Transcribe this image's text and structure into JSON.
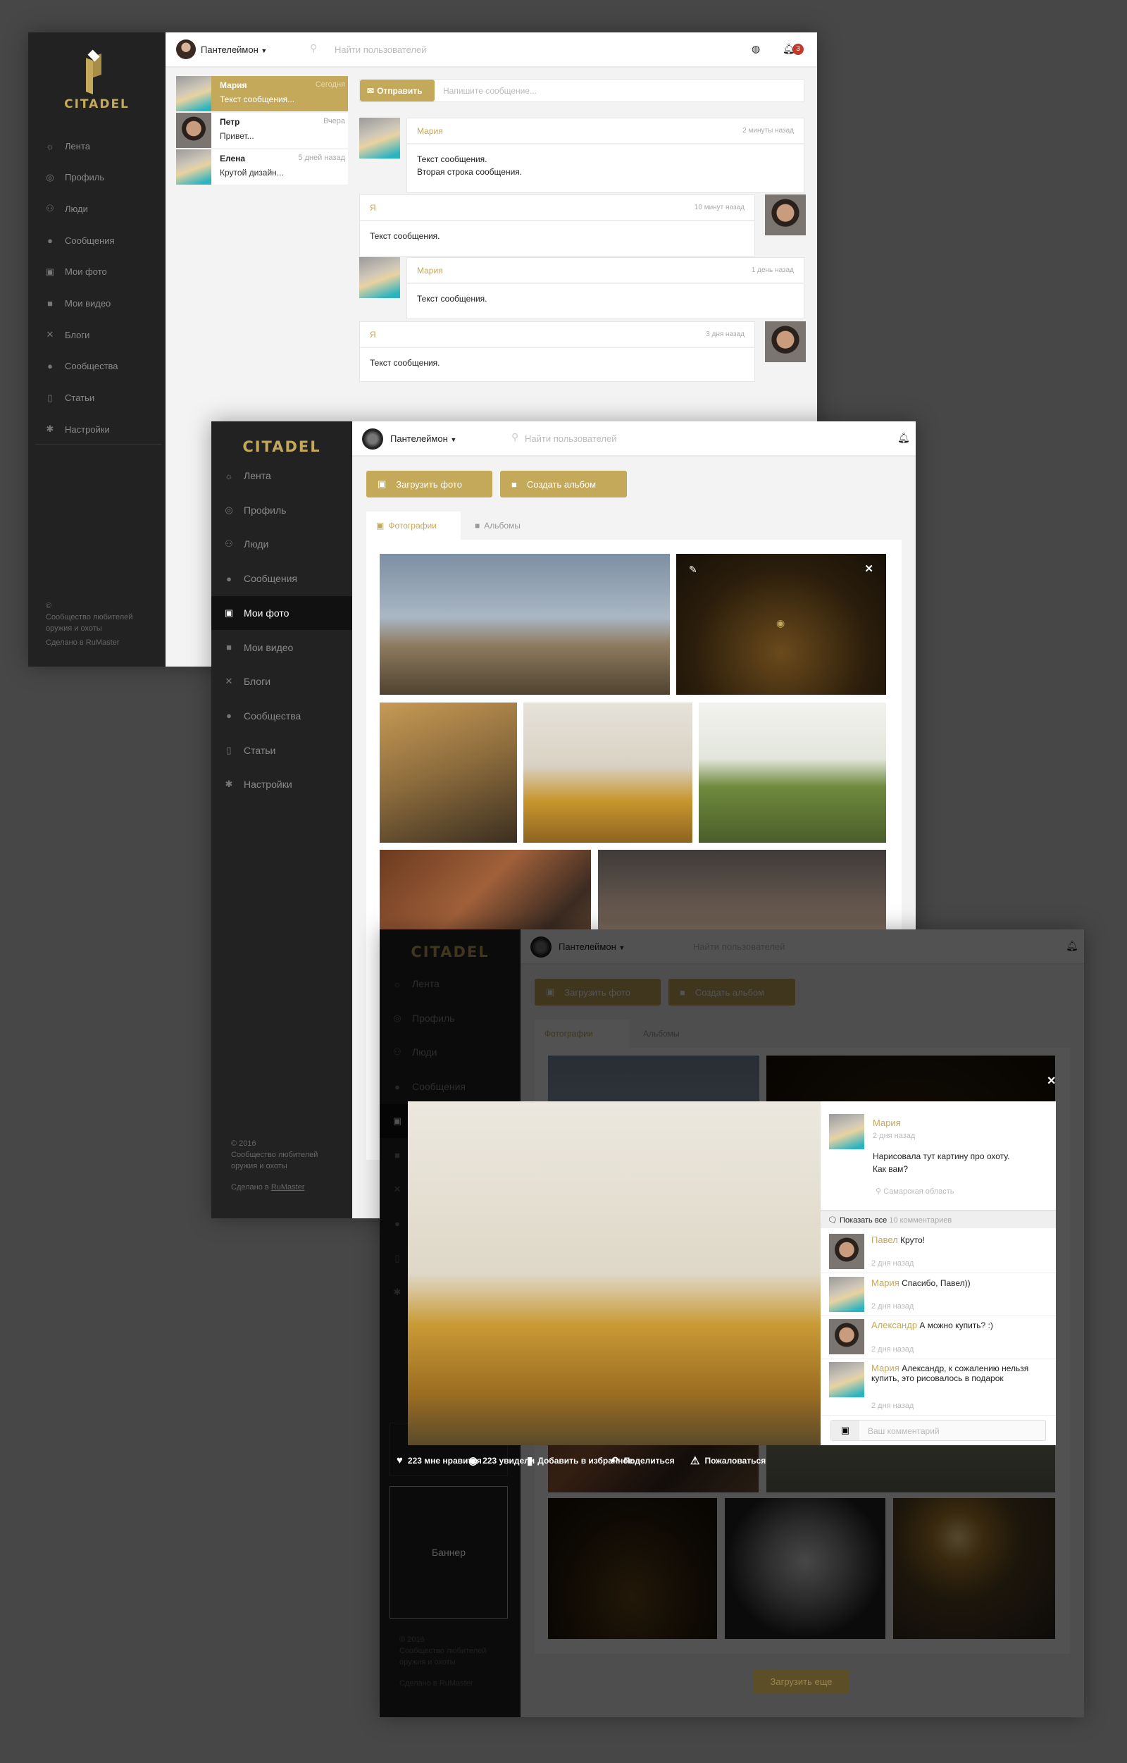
{
  "brand": {
    "name": "CITADEL",
    "accent": "#c4a95b",
    "sidebar_bg": "#222222"
  },
  "nav": [
    {
      "label": "Лента",
      "icon": "☼",
      "name": "feed-icon"
    },
    {
      "label": "Профиль",
      "icon": "◎",
      "name": "profile-icon"
    },
    {
      "label": "Люди",
      "icon": "⚇",
      "name": "people-icon"
    },
    {
      "label": "Сообщения",
      "icon": "●",
      "name": "messages-icon"
    },
    {
      "label": "Мои фото",
      "icon": "▣",
      "name": "photo-icon"
    },
    {
      "label": "Мои видео",
      "icon": "■",
      "name": "video-icon"
    },
    {
      "label": "Блоги",
      "icon": "✕",
      "name": "blogs-icon"
    },
    {
      "label": "Сообщества",
      "icon": "●",
      "name": "communities-icon"
    },
    {
      "label": "Статьи",
      "icon": "▯",
      "name": "articles-icon"
    },
    {
      "label": "Настройки",
      "icon": "✱",
      "name": "settings-icon"
    }
  ],
  "topbar": {
    "user": "Пантелеймон",
    "search_placeholder": "Найти пользователей",
    "notifications": "3"
  },
  "footer1": {
    "copy": "©",
    "line1": "Сообщество любителей",
    "line2": "оружия и охоты",
    "made": "Сделано в RuMaster"
  },
  "footer2": {
    "copy": "© 2016",
    "line1": "Сообщество любителей",
    "line2": "оружия и охоты",
    "made_prefix": "Сделано в",
    "made_link": "RuMaster"
  },
  "messages_page": {
    "conversations": [
      {
        "name": "Мария",
        "date": "Сегодня",
        "preview": "Текст сообщения...",
        "selected": true,
        "avatar": "fem"
      },
      {
        "name": "Петр",
        "date": "Вчера",
        "preview": "Привет...",
        "selected": false,
        "avatar": "mal"
      },
      {
        "name": "Елена",
        "date": "5 дней назад",
        "preview": "Крутой дизайн...",
        "selected": false,
        "avatar": "fem"
      }
    ],
    "send_label": "Отправить",
    "compose_placeholder": "Напишите сообщение...",
    "thread": [
      {
        "author": "Мария",
        "time": "2 минуты назад",
        "lines": [
          "Текст сообщения.",
          "Вторая строка сообщения."
        ],
        "mine": false
      },
      {
        "author": "Я",
        "time": "10 минут назад",
        "lines": [
          "Текст сообщения."
        ],
        "mine": true
      },
      {
        "author": "Мария",
        "time": "1 день назад",
        "lines": [
          "Текст сообщения."
        ],
        "mine": false
      },
      {
        "author": "Я",
        "time": "3 дня назад",
        "lines": [
          "Текст сообщения."
        ],
        "mine": true
      }
    ]
  },
  "photos_page": {
    "upload_label": "Загрузить фото",
    "album_label": "Создать альбом",
    "tabs": [
      {
        "label": "Фотографии",
        "active": true
      },
      {
        "label": "Альбомы",
        "active": false
      }
    ],
    "load_more": "Загрузить еще",
    "banner": "Баннер"
  },
  "viewer": {
    "post": {
      "author": "Мария",
      "time": "2 дня назад",
      "text1": "Нарисовала тут картину про охоту.",
      "text2": "Как вам?",
      "location": "Самарская область"
    },
    "show_all": "Показать все",
    "comment_count": "10 комментариев",
    "comments": [
      {
        "author": "Павел",
        "text": "Круто!",
        "time": "2 дня назад",
        "avatar": "mal"
      },
      {
        "author": "Мария",
        "text": "Спасибо, Павел))",
        "time": "2 дня назад",
        "avatar": "fem"
      },
      {
        "author": "Александр",
        "text": "А можно купить? :)",
        "time": "2 дня назад",
        "avatar": "mal"
      },
      {
        "author": "Мария",
        "text": "Александр, к сожалению нельзя купить, это рисовалось в подарок",
        "time": "2 дня назад",
        "avatar": "fem"
      }
    ],
    "comment_placeholder": "Ваш комментарий",
    "likes": "223 мне нравится",
    "views": "223 увидели",
    "favorite": "Добавить в избранное",
    "share": "Поделиться",
    "report": "Пожаловаться"
  }
}
